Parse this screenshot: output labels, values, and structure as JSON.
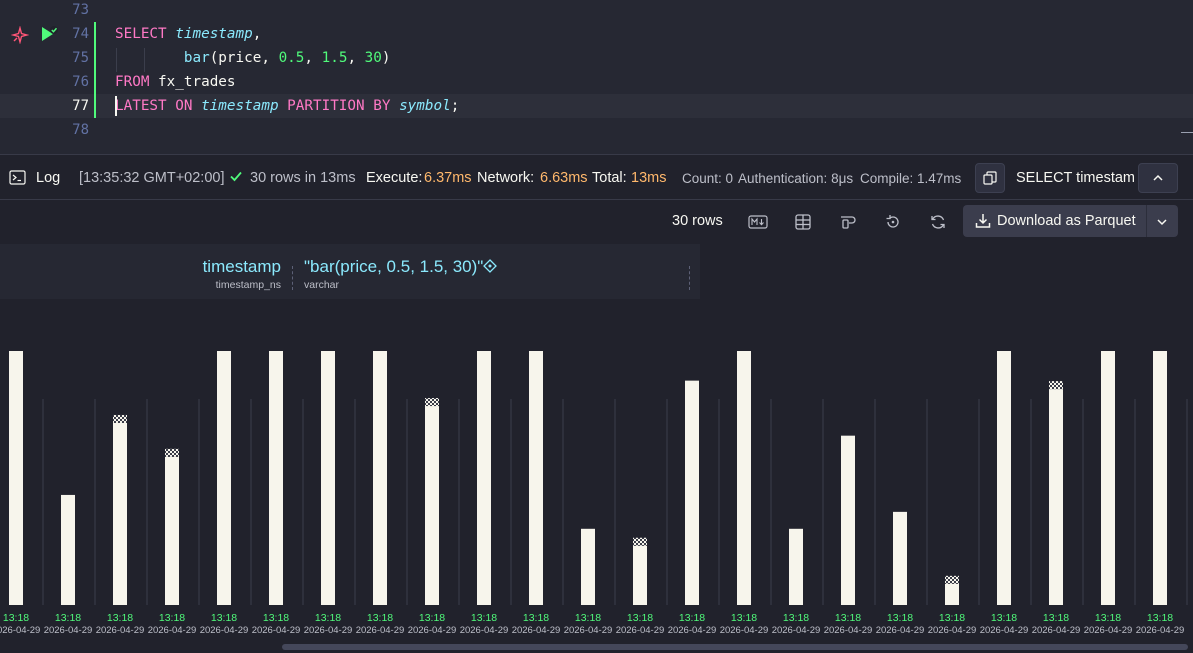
{
  "editor": {
    "lines": [
      {
        "number": "73",
        "tokens": []
      },
      {
        "number": "74",
        "tokens": [
          {
            "t": "SELECT",
            "c": "kw"
          },
          {
            "t": " "
          },
          {
            "t": "timestamp",
            "c": "it"
          },
          {
            "t": ","
          }
        ]
      },
      {
        "number": "75",
        "tokens": [
          {
            "t": "        "
          },
          {
            "t": "bar",
            "c": "fn"
          },
          {
            "t": "(price, "
          },
          {
            "t": "0.5",
            "c": "num"
          },
          {
            "t": ", "
          },
          {
            "t": "1.5",
            "c": "num"
          },
          {
            "t": ", "
          },
          {
            "t": "30",
            "c": "num"
          },
          {
            "t": ")"
          }
        ]
      },
      {
        "number": "76",
        "tokens": [
          {
            "t": "FROM",
            "c": "kw"
          },
          {
            "t": " fx_trades"
          }
        ]
      },
      {
        "number": "77",
        "tokens": [
          {
            "t": "LATEST ON",
            "c": "kw"
          },
          {
            "t": " "
          },
          {
            "t": "timestamp",
            "c": "it"
          },
          {
            "t": " "
          },
          {
            "t": "PARTITION BY",
            "c": "kw"
          },
          {
            "t": " "
          },
          {
            "t": "symbol",
            "c": "it"
          },
          {
            "t": ";"
          }
        ]
      },
      {
        "number": "78",
        "tokens": []
      }
    ],
    "active_line": "77"
  },
  "log": {
    "label": "Log",
    "timestamp": "[13:35:32 GMT+02:00]",
    "rows_msg": "30 rows in 13ms",
    "execute_label": "Execute:",
    "execute_value": "6.37ms",
    "network_label": "Network:",
    "network_value": "6.63ms",
    "total_label": "Total:",
    "total_value": "13ms",
    "count": "Count: 0",
    "authentication": "Authentication: 8μs",
    "compile": "Compile: 1.47ms",
    "query_preview": "SELECT timestam"
  },
  "toolbar": {
    "rows": "30 rows",
    "download_label": "Download as Parquet"
  },
  "grid": {
    "columns": [
      {
        "name": "timestamp",
        "type": "timestamp_ns"
      },
      {
        "name": "\"bar(price, 0.5, 1.5, 30)\"",
        "type": "varchar"
      }
    ]
  },
  "chart_data": {
    "type": "bar",
    "title": "",
    "xlabel": "",
    "ylabel": "",
    "ylim": [
      0,
      30
    ],
    "categories": [
      "13:18",
      "13:18",
      "13:18",
      "13:18",
      "13:18",
      "13:18",
      "13:18",
      "13:18",
      "13:18",
      "13:18",
      "13:18",
      "13:18",
      "13:18",
      "13:18",
      "13:18",
      "13:18",
      "13:18",
      "13:18",
      "13:18",
      "13:18",
      "13:18",
      "13:18",
      "13:18"
    ],
    "dates": [
      "2026-04-29",
      "2026-04-29",
      "2026-04-29",
      "2026-04-29",
      "2026-04-29",
      "2026-04-29",
      "2026-04-29",
      "2026-04-29",
      "2026-04-29",
      "2026-04-29",
      "2026-04-29",
      "2026-04-29",
      "2026-04-29",
      "2026-04-29",
      "2026-04-29",
      "2026-04-29",
      "2026-04-29",
      "2026-04-29",
      "2026-04-29",
      "2026-04-29",
      "2026-04-29",
      "2026-04-29",
      "2026-04-29"
    ],
    "values": [
      30,
      13,
      21.5,
      17.5,
      30,
      30,
      30,
      30,
      23.5,
      30,
      30,
      9,
      7,
      26.5,
      30,
      9,
      20,
      11,
      2.5,
      30,
      25.5,
      30,
      30
    ],
    "partial_top": [
      false,
      false,
      true,
      true,
      false,
      false,
      false,
      false,
      true,
      false,
      false,
      false,
      true,
      false,
      false,
      false,
      false,
      false,
      true,
      false,
      true,
      false,
      false
    ],
    "colors": {
      "bar": "#f7f5ec",
      "time": "#50fa7b",
      "date": "#bdbfc9",
      "guide": "#3a3d4b"
    }
  }
}
